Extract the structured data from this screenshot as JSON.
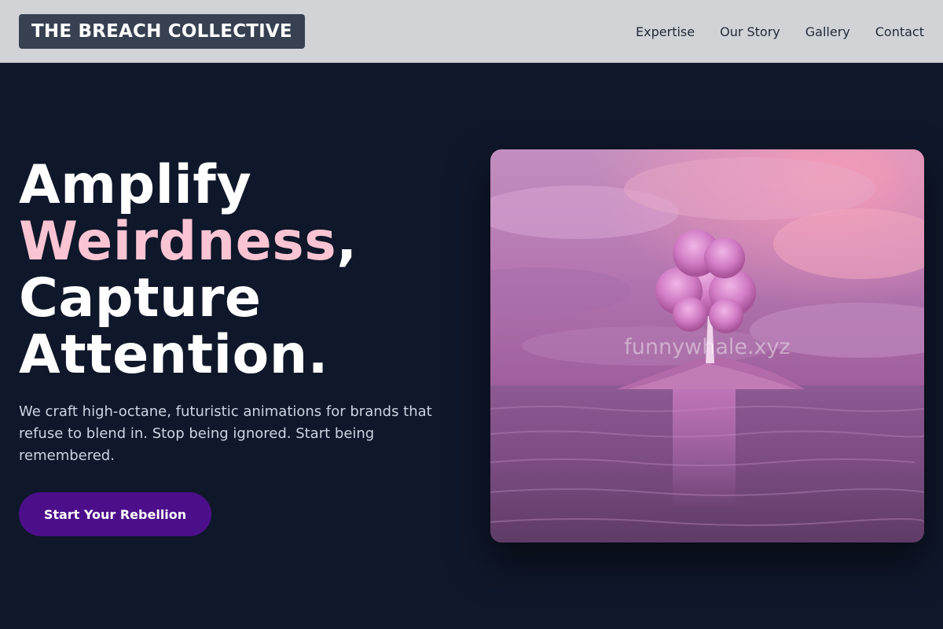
{
  "header": {
    "logo": "THE BREACH COLLECTIVE",
    "nav": [
      "Expertise",
      "Our Story",
      "Gallery",
      "Contact"
    ]
  },
  "hero": {
    "headline_line1": "Amplify",
    "headline_accent": "Weirdness",
    "headline_comma": ",",
    "headline_line3": "Capture",
    "headline_line4": "Attention.",
    "subtext": "We craft high-octane, futuristic animations for brands that refuse to blend in. Stop being ignored. Start being remembered.",
    "cta_label": "Start Your Rebellion",
    "image_watermark": "funnywhale.xyz"
  },
  "colors": {
    "background": "#0f172a",
    "header_background": "#d1d3d7",
    "logo_background": "#374151",
    "accent_text": "#fbc4d3",
    "cta_background": "#4c0f8a"
  }
}
